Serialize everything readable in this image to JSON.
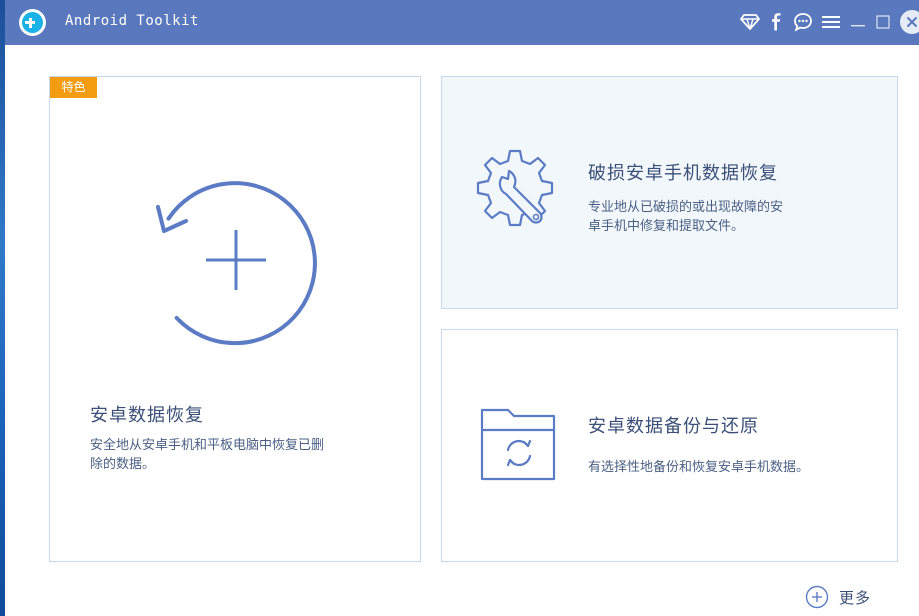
{
  "app": {
    "title": "Android Toolkit"
  },
  "titlebar": {
    "icons": [
      "diamond-icon",
      "facebook-icon",
      "chat-icon",
      "menu-icon",
      "minimize-icon",
      "maximize-icon",
      "close-icon"
    ]
  },
  "cards": {
    "recovery": {
      "badge": "特色",
      "title": "安卓数据恢复",
      "desc_line1": "安全地从安卓手机和平板电脑中恢复已删",
      "desc_line2": "除的数据。"
    },
    "broken": {
      "title": "破损安卓手机数据恢复",
      "desc_line1": "专业地从已破损的或出现故障的安",
      "desc_line2": "卓手机中修复和提取文件。"
    },
    "backup": {
      "title": "安卓数据备份与还原",
      "desc": "有选择性地备份和恢复安卓手机数据。"
    }
  },
  "more": {
    "label": "更多"
  },
  "colors": {
    "titlebar": "#5978bd",
    "accent": "#5b7cc4",
    "badge": "#f39c12",
    "card_border": "#c5d8ee"
  }
}
